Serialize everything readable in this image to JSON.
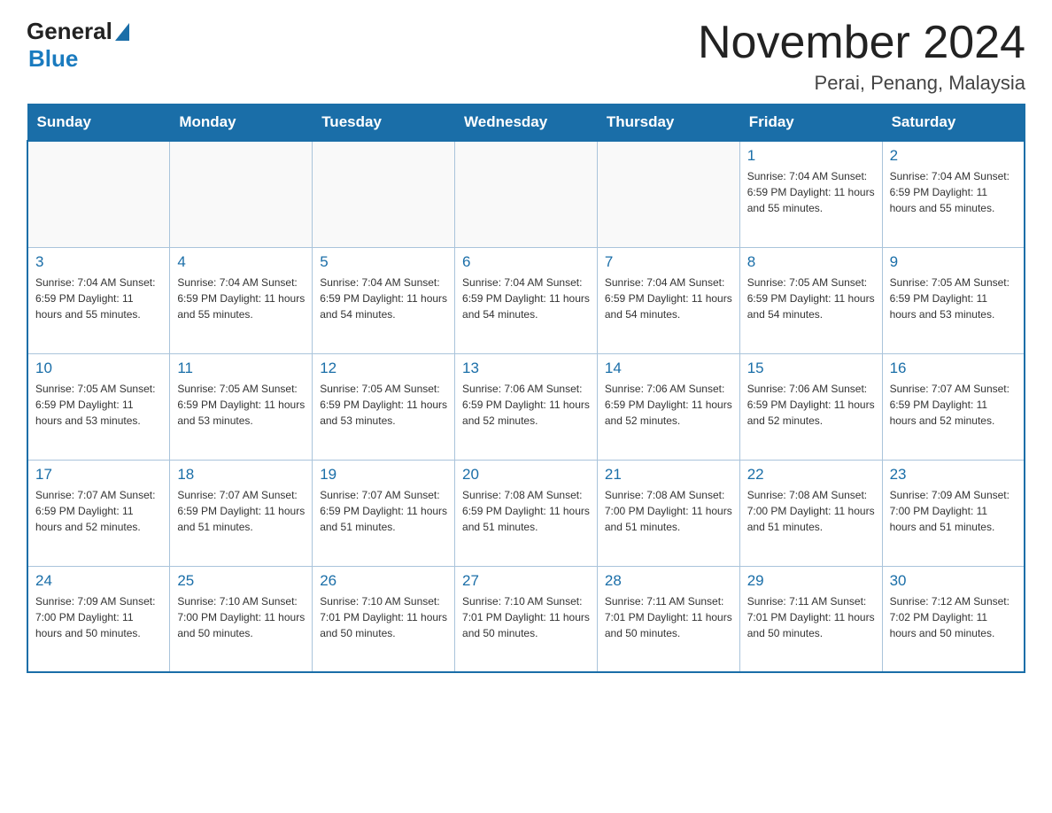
{
  "header": {
    "logo_general": "General",
    "logo_blue": "Blue",
    "title": "November 2024",
    "subtitle": "Perai, Penang, Malaysia"
  },
  "days_of_week": [
    "Sunday",
    "Monday",
    "Tuesday",
    "Wednesday",
    "Thursday",
    "Friday",
    "Saturday"
  ],
  "weeks": [
    [
      {
        "day": "",
        "info": ""
      },
      {
        "day": "",
        "info": ""
      },
      {
        "day": "",
        "info": ""
      },
      {
        "day": "",
        "info": ""
      },
      {
        "day": "",
        "info": ""
      },
      {
        "day": "1",
        "info": "Sunrise: 7:04 AM\nSunset: 6:59 PM\nDaylight: 11 hours\nand 55 minutes."
      },
      {
        "day": "2",
        "info": "Sunrise: 7:04 AM\nSunset: 6:59 PM\nDaylight: 11 hours\nand 55 minutes."
      }
    ],
    [
      {
        "day": "3",
        "info": "Sunrise: 7:04 AM\nSunset: 6:59 PM\nDaylight: 11 hours\nand 55 minutes."
      },
      {
        "day": "4",
        "info": "Sunrise: 7:04 AM\nSunset: 6:59 PM\nDaylight: 11 hours\nand 55 minutes."
      },
      {
        "day": "5",
        "info": "Sunrise: 7:04 AM\nSunset: 6:59 PM\nDaylight: 11 hours\nand 54 minutes."
      },
      {
        "day": "6",
        "info": "Sunrise: 7:04 AM\nSunset: 6:59 PM\nDaylight: 11 hours\nand 54 minutes."
      },
      {
        "day": "7",
        "info": "Sunrise: 7:04 AM\nSunset: 6:59 PM\nDaylight: 11 hours\nand 54 minutes."
      },
      {
        "day": "8",
        "info": "Sunrise: 7:05 AM\nSunset: 6:59 PM\nDaylight: 11 hours\nand 54 minutes."
      },
      {
        "day": "9",
        "info": "Sunrise: 7:05 AM\nSunset: 6:59 PM\nDaylight: 11 hours\nand 53 minutes."
      }
    ],
    [
      {
        "day": "10",
        "info": "Sunrise: 7:05 AM\nSunset: 6:59 PM\nDaylight: 11 hours\nand 53 minutes."
      },
      {
        "day": "11",
        "info": "Sunrise: 7:05 AM\nSunset: 6:59 PM\nDaylight: 11 hours\nand 53 minutes."
      },
      {
        "day": "12",
        "info": "Sunrise: 7:05 AM\nSunset: 6:59 PM\nDaylight: 11 hours\nand 53 minutes."
      },
      {
        "day": "13",
        "info": "Sunrise: 7:06 AM\nSunset: 6:59 PM\nDaylight: 11 hours\nand 52 minutes."
      },
      {
        "day": "14",
        "info": "Sunrise: 7:06 AM\nSunset: 6:59 PM\nDaylight: 11 hours\nand 52 minutes."
      },
      {
        "day": "15",
        "info": "Sunrise: 7:06 AM\nSunset: 6:59 PM\nDaylight: 11 hours\nand 52 minutes."
      },
      {
        "day": "16",
        "info": "Sunrise: 7:07 AM\nSunset: 6:59 PM\nDaylight: 11 hours\nand 52 minutes."
      }
    ],
    [
      {
        "day": "17",
        "info": "Sunrise: 7:07 AM\nSunset: 6:59 PM\nDaylight: 11 hours\nand 52 minutes."
      },
      {
        "day": "18",
        "info": "Sunrise: 7:07 AM\nSunset: 6:59 PM\nDaylight: 11 hours\nand 51 minutes."
      },
      {
        "day": "19",
        "info": "Sunrise: 7:07 AM\nSunset: 6:59 PM\nDaylight: 11 hours\nand 51 minutes."
      },
      {
        "day": "20",
        "info": "Sunrise: 7:08 AM\nSunset: 6:59 PM\nDaylight: 11 hours\nand 51 minutes."
      },
      {
        "day": "21",
        "info": "Sunrise: 7:08 AM\nSunset: 7:00 PM\nDaylight: 11 hours\nand 51 minutes."
      },
      {
        "day": "22",
        "info": "Sunrise: 7:08 AM\nSunset: 7:00 PM\nDaylight: 11 hours\nand 51 minutes."
      },
      {
        "day": "23",
        "info": "Sunrise: 7:09 AM\nSunset: 7:00 PM\nDaylight: 11 hours\nand 51 minutes."
      }
    ],
    [
      {
        "day": "24",
        "info": "Sunrise: 7:09 AM\nSunset: 7:00 PM\nDaylight: 11 hours\nand 50 minutes."
      },
      {
        "day": "25",
        "info": "Sunrise: 7:10 AM\nSunset: 7:00 PM\nDaylight: 11 hours\nand 50 minutes."
      },
      {
        "day": "26",
        "info": "Sunrise: 7:10 AM\nSunset: 7:01 PM\nDaylight: 11 hours\nand 50 minutes."
      },
      {
        "day": "27",
        "info": "Sunrise: 7:10 AM\nSunset: 7:01 PM\nDaylight: 11 hours\nand 50 minutes."
      },
      {
        "day": "28",
        "info": "Sunrise: 7:11 AM\nSunset: 7:01 PM\nDaylight: 11 hours\nand 50 minutes."
      },
      {
        "day": "29",
        "info": "Sunrise: 7:11 AM\nSunset: 7:01 PM\nDaylight: 11 hours\nand 50 minutes."
      },
      {
        "day": "30",
        "info": "Sunrise: 7:12 AM\nSunset: 7:02 PM\nDaylight: 11 hours\nand 50 minutes."
      }
    ]
  ]
}
